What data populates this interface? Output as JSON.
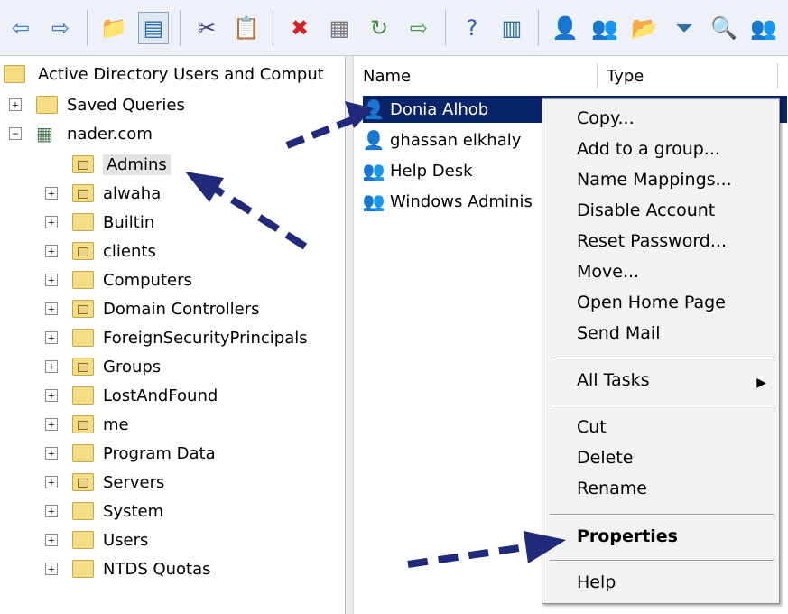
{
  "toolbar": {
    "buttons": [
      {
        "name": "back-arrow-icon",
        "glyph": "⇦",
        "color": "#3a7bd5"
      },
      {
        "name": "forward-arrow-icon",
        "glyph": "⇨",
        "color": "#3a7bd5"
      },
      {
        "name": "up-folder-icon",
        "glyph": "📁",
        "color": "#d2a92c"
      },
      {
        "name": "show-hide-console-tree-icon",
        "glyph": "▤",
        "color": "#2e6fa7"
      },
      {
        "name": "cut-icon",
        "glyph": "✂",
        "color": "#3b3b8a"
      },
      {
        "name": "paste-icon",
        "glyph": "📋",
        "color": "#6b5b2e"
      },
      {
        "name": "delete-icon",
        "glyph": "✖",
        "color": "#d62222"
      },
      {
        "name": "properties-icon",
        "glyph": "▦",
        "color": "#7a7a7a"
      },
      {
        "name": "refresh-icon",
        "glyph": "↻",
        "color": "#4a8a4a"
      },
      {
        "name": "export-list-icon",
        "glyph": "⇨",
        "color": "#3f9b3f"
      },
      {
        "name": "help-icon",
        "glyph": "?",
        "color": "#2d5fb6"
      },
      {
        "name": "action-pane-icon",
        "glyph": "▥",
        "color": "#2e6fa7"
      },
      {
        "name": "new-user-icon",
        "glyph": "👤",
        "color": "#2f4f9a"
      },
      {
        "name": "new-group-icon",
        "glyph": "👥",
        "color": "#2f7a3f"
      },
      {
        "name": "new-ou-icon",
        "glyph": "📂",
        "color": "#d2a92c"
      },
      {
        "name": "filter-icon",
        "glyph": "⏷",
        "color": "#2e6fa7"
      },
      {
        "name": "find-icon",
        "glyph": "🔍",
        "color": "#6f6f2e"
      },
      {
        "name": "add-to-group-icon",
        "glyph": "👥",
        "color": "#2f4f9a"
      }
    ]
  },
  "tree": {
    "root_label": "Active Directory Users and Comput",
    "saved_queries": "Saved Queries",
    "domain": "nader.com",
    "children": [
      {
        "label": "Admins",
        "ou": true,
        "expandable": false,
        "selected": true
      },
      {
        "label": "alwaha",
        "ou": true,
        "expandable": true
      },
      {
        "label": "Builtin",
        "ou": false,
        "expandable": true
      },
      {
        "label": "clients",
        "ou": true,
        "expandable": true
      },
      {
        "label": "Computers",
        "ou": false,
        "expandable": true
      },
      {
        "label": "Domain Controllers",
        "ou": true,
        "expandable": true
      },
      {
        "label": "ForeignSecurityPrincipals",
        "ou": false,
        "expandable": true
      },
      {
        "label": "Groups",
        "ou": true,
        "expandable": true
      },
      {
        "label": "LostAndFound",
        "ou": false,
        "expandable": true
      },
      {
        "label": "me",
        "ou": true,
        "expandable": true
      },
      {
        "label": "Program Data",
        "ou": false,
        "expandable": true
      },
      {
        "label": "Servers",
        "ou": true,
        "expandable": true
      },
      {
        "label": "System",
        "ou": false,
        "expandable": true
      },
      {
        "label": "Users",
        "ou": false,
        "expandable": true
      },
      {
        "label": "NTDS Quotas",
        "ou": false,
        "expandable": true
      }
    ]
  },
  "list": {
    "columns": {
      "name": "Name",
      "type": "Type"
    },
    "items": [
      {
        "label": "Donia Alhob",
        "icon": "user-icon",
        "selected": true
      },
      {
        "label": "ghassan elkhaly",
        "icon": "user-icon",
        "selected": false
      },
      {
        "label": "Help Desk",
        "icon": "group-icon",
        "selected": false
      },
      {
        "label": "Windows Adminis",
        "icon": "group-icon",
        "selected": false
      }
    ]
  },
  "context_menu": {
    "group1": [
      "Copy...",
      "Add to a group...",
      "Name Mappings...",
      "Disable Account",
      "Reset Password...",
      "Move...",
      "Open Home Page",
      "Send Mail"
    ],
    "all_tasks": "All Tasks",
    "group3": [
      "Cut",
      "Delete",
      "Rename"
    ],
    "properties": "Properties",
    "help": "Help"
  },
  "colors": {
    "selection_blue": "#0a246a",
    "arrow_blue": "#1f2a7a"
  }
}
